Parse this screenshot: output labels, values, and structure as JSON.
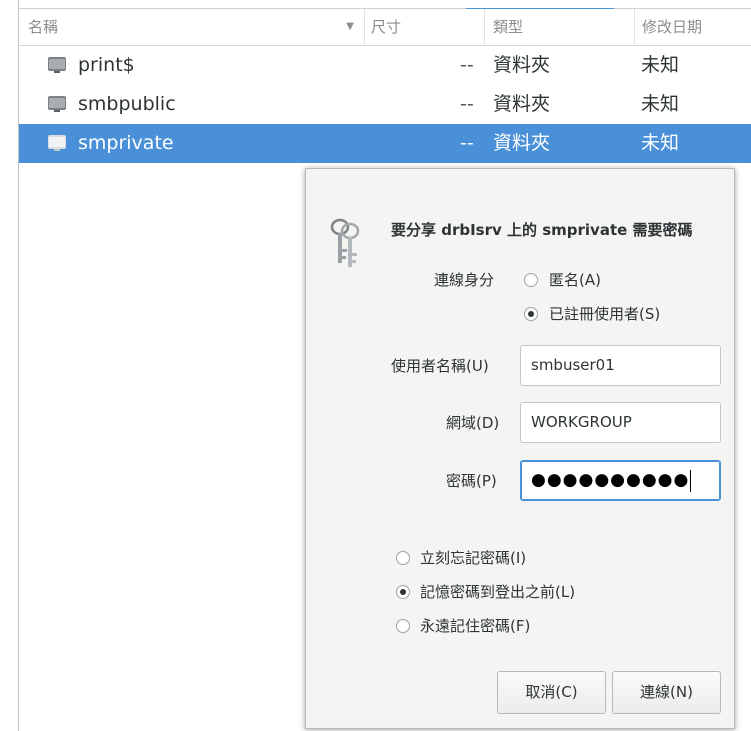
{
  "columns": {
    "name": "名稱",
    "size": "尺寸",
    "type": "類型",
    "modified": "修改日期"
  },
  "files": [
    {
      "name": "print$",
      "size": "--",
      "type": "資料夾",
      "modified": "未知",
      "icon": "network-folder-icon"
    },
    {
      "name": "smbpublic",
      "size": "--",
      "type": "資料夾",
      "modified": "未知",
      "icon": "network-folder-icon"
    },
    {
      "name": "smprivate",
      "size": "--",
      "type": "資料夾",
      "modified": "未知",
      "icon": "network-folder-icon",
      "selected": true
    }
  ],
  "colors": {
    "selection": "#4a90d9",
    "dialog_bg": "#f4f4f3",
    "focus": "#4a90d9"
  },
  "dialog": {
    "icon": "keys-icon",
    "title": "要分享 drbIsrv 上的 smprivate 需要密碼",
    "connect_as_label": "連線身分",
    "anonymous_option": "匿名(A)",
    "registered_option": "已註冊使用者(S)",
    "connect_as_selected": "registered",
    "username_label": "使用者名稱(U)",
    "username_value": "smbuser01",
    "domain_label": "網域(D)",
    "domain_value": "WORKGROUP",
    "password_label": "密碼(P)",
    "password_value": "●●●●●●●●●●",
    "remember_options": [
      {
        "label": "立刻忘記密碼(I)",
        "checked": false
      },
      {
        "label": "記憶密碼到登出之前(L)",
        "checked": true
      },
      {
        "label": "永遠記住密碼(F)",
        "checked": false
      }
    ],
    "cancel_button": "取消(C)",
    "connect_button": "連線(N)"
  }
}
